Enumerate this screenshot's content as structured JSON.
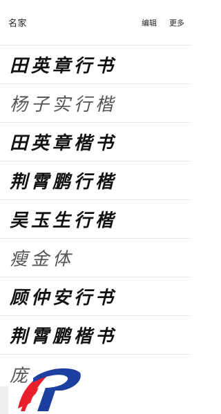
{
  "header": {
    "title": "名家",
    "edit_label": "编辑",
    "more_label": "更多"
  },
  "fonts": [
    {
      "name": "田英章行书"
    },
    {
      "name": "杨子实行楷"
    },
    {
      "name": "田英章楷书"
    },
    {
      "name": "荆霄鹏行楷"
    },
    {
      "name": "吴玉生行楷"
    },
    {
      "name": "瘦金体"
    },
    {
      "name": "顾仲安行书"
    },
    {
      "name": "荆霄鹏楷书"
    },
    {
      "name": "庞"
    }
  ],
  "colors": {
    "logo_red": "#e8202b",
    "logo_blue": "#1d3fa0",
    "divider": "#e9e9e9"
  },
  "icons": {
    "watermark": "app-logo-icon"
  }
}
